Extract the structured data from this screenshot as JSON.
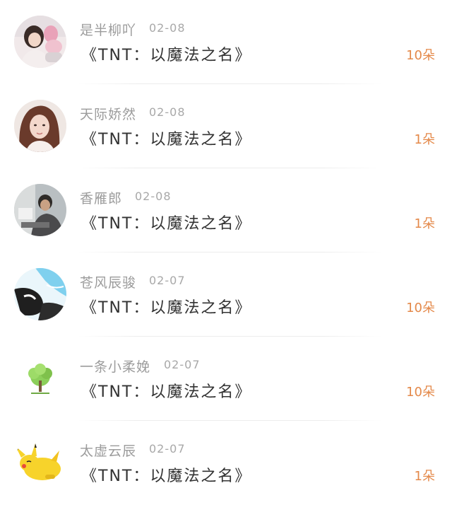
{
  "items": [
    {
      "name": "是半柳吖",
      "date": "02-08",
      "title": "《TNT：以魔法之名》",
      "count": "10朵",
      "avatar": "girl-with-doll-photo"
    },
    {
      "name": "天际娇然",
      "date": "02-08",
      "title": "《TNT：以魔法之名》",
      "count": "1朵",
      "avatar": "girl-portrait-photo"
    },
    {
      "name": "香雁郎",
      "date": "02-08",
      "title": "《TNT：以魔法之名》",
      "count": "1朵",
      "avatar": "man-at-desk-photo"
    },
    {
      "name": "苍风辰骏",
      "date": "02-07",
      "title": "《TNT：以魔法之名》",
      "count": "10朵",
      "avatar": "anime-art-blue"
    },
    {
      "name": "一条小柔娩",
      "date": "02-07",
      "title": "《TNT：以魔法之名》",
      "count": "10朵",
      "avatar": "green-tree"
    },
    {
      "name": "太虚云辰",
      "date": "02-07",
      "title": "《TNT：以魔法之名》",
      "count": "1朵",
      "avatar": "pikachu-sleeping"
    }
  ],
  "colors": {
    "count": "#e4894a",
    "name": "#9c9c9c",
    "title": "#333333"
  }
}
